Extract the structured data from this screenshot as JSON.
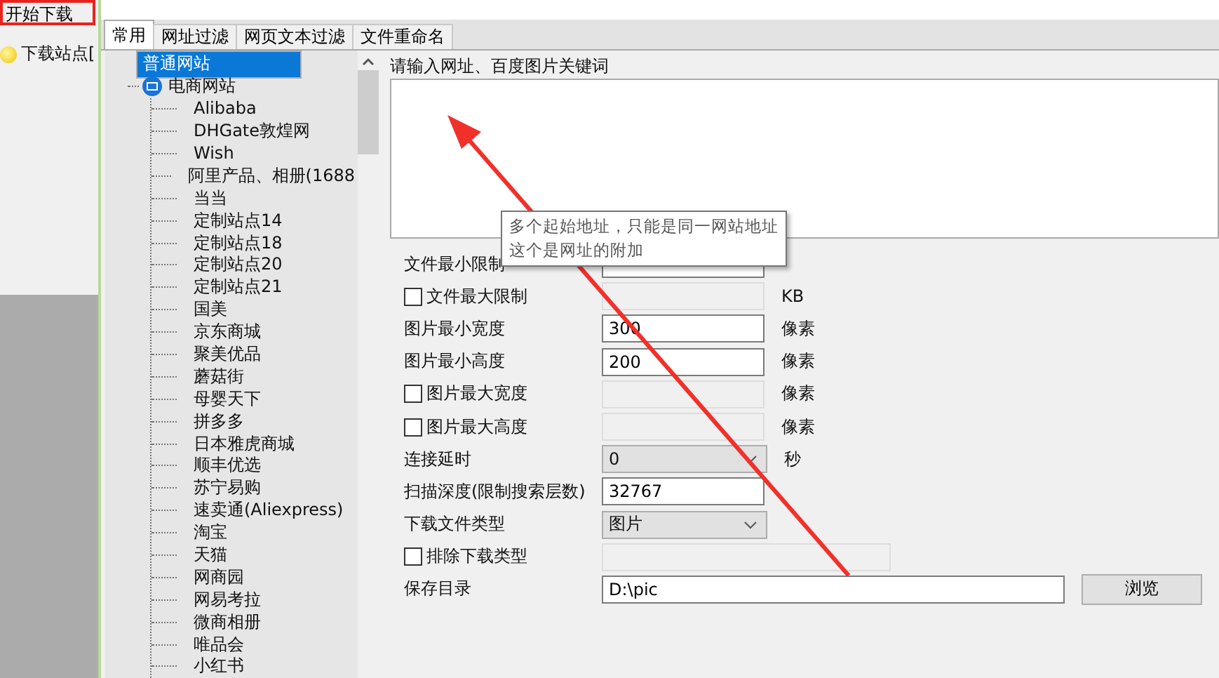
{
  "background_window": {
    "start_button": "开始下载",
    "site_item": {
      "label": "下载站点[",
      "selected": false
    }
  },
  "tabs": [
    {
      "label": "常用",
      "selected": true
    },
    {
      "label": "网址过滤",
      "selected": false
    },
    {
      "label": "网页文本过滤",
      "selected": false
    },
    {
      "label": "文件重命名",
      "selected": false
    }
  ],
  "tree": {
    "label": "普通网站",
    "selected": true,
    "children": [
      {
        "label": "电商网站",
        "expanded": true,
        "children": [
          {
            "label": "Alibaba"
          },
          {
            "label": "DHGate敦煌网"
          },
          {
            "label": "Wish"
          },
          {
            "label": "阿里产品、相册(1688"
          },
          {
            "label": "当当"
          },
          {
            "label": "定制站点14"
          },
          {
            "label": "定制站点18"
          },
          {
            "label": "定制站点20"
          },
          {
            "label": "定制站点21"
          },
          {
            "label": "国美"
          },
          {
            "label": "京东商城"
          },
          {
            "label": "聚美优品"
          },
          {
            "label": "蘑菇街"
          },
          {
            "label": "母婴天下"
          },
          {
            "label": "拼多多"
          },
          {
            "label": "日本雅虎商城"
          },
          {
            "label": "顺丰优选"
          },
          {
            "label": "苏宁易购"
          },
          {
            "label": "速卖通(Aliexpress)"
          },
          {
            "label": "淘宝"
          },
          {
            "label": "天猫"
          },
          {
            "label": "网商园"
          },
          {
            "label": "网易考拉"
          },
          {
            "label": "微商相册"
          },
          {
            "label": "唯品会"
          },
          {
            "label": "小红书"
          }
        ]
      }
    ]
  },
  "url_input": {
    "label": "请输入网址、百度图片关键词"
  },
  "tooltip": {
    "lines": [
      "多个起始地址，只能是同一网站地址",
      "这个是网址的附加"
    ]
  },
  "form": [
    {
      "kind": "text",
      "label": "文件最小限制"
    },
    {
      "kind": "check",
      "label": "文件最大限制",
      "checked": false,
      "unit": "KB"
    },
    {
      "kind": "text",
      "label": "图片最小宽度",
      "value": "300",
      "unit": "像素"
    },
    {
      "kind": "text",
      "label": "图片最小高度",
      "value": "200",
      "unit": "像素"
    },
    {
      "kind": "check",
      "label": "图片最大宽度",
      "checked": false,
      "unit": "像素"
    },
    {
      "kind": "check",
      "label": "图片最大高度",
      "checked": false,
      "unit": "像素"
    },
    {
      "kind": "select",
      "label": "连接延时",
      "value": "0",
      "unit": "秒"
    },
    {
      "kind": "text",
      "label": "扫描深度(限制搜索层数)",
      "value": "32767"
    },
    {
      "kind": "select",
      "label": "下载文件类型",
      "value": "图片"
    },
    {
      "kind": "check",
      "label": "排除下载类型",
      "checked": false,
      "wide": true
    },
    {
      "kind": "path",
      "label": "保存目录",
      "value": "D:\\pic",
      "button": "浏览"
    }
  ]
}
